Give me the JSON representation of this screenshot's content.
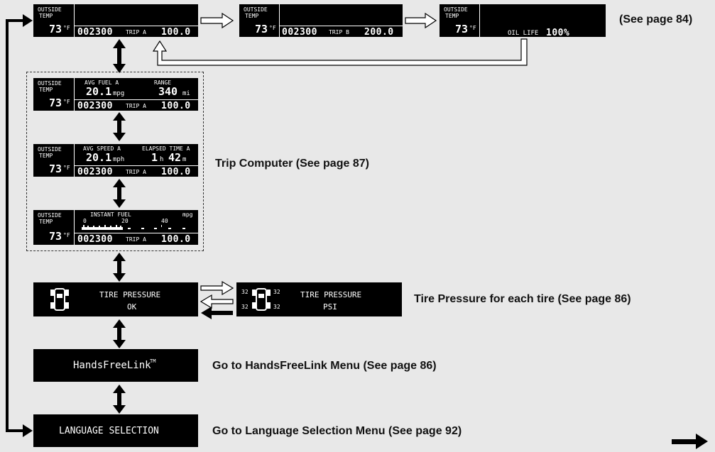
{
  "common": {
    "outside": "OUTSIDE",
    "temp": "TEMP",
    "temp_value": "73",
    "temp_unit": "°F",
    "odometer": "002300"
  },
  "top_displays": [
    {
      "trip_label": "TRIP A",
      "trip_value": "100.0"
    },
    {
      "trip_label": "TRIP B",
      "trip_value": "200.0"
    },
    {
      "oil_life_label": "OIL LIFE",
      "oil_life_value": "100%"
    }
  ],
  "top_caption": "(See page 84)",
  "trip_computer": {
    "caption": "Trip Computer (See page 87)",
    "d1": {
      "left_label": "AVG FUEL A",
      "left_value": "20.1",
      "left_unit": "mpg",
      "right_label": "RANGE",
      "right_value": "340",
      "right_unit": "mi",
      "trip_label": "TRIP A",
      "trip_value": "100.0"
    },
    "d2": {
      "left_label": "AVG SPEED A",
      "left_value": "20.1",
      "left_unit": "mph",
      "right_label": "ELAPSED TIME A",
      "hours": "1",
      "h_unit": "h",
      "minutes": "42",
      "m_unit": "m",
      "trip_label": "TRIP A",
      "trip_value": "100.0"
    },
    "d3": {
      "label": "INSTANT FUEL",
      "unit": "mpg",
      "tick0": "0",
      "tick20": "20",
      "tick40": "40",
      "trip_label": "TRIP A",
      "trip_value": "100.0"
    }
  },
  "tire": {
    "title": "TIRE PRESSURE",
    "status": "OK",
    "psi_label": "PSI",
    "fl": "32",
    "fr": "32",
    "rl": "32",
    "rr": "32",
    "caption": "Tire Pressure for each tire (See page 86)"
  },
  "hfl": {
    "label": "HandsFreeLink",
    "tm": "TM",
    "caption": "Go to HandsFreeLink Menu (See page 86)"
  },
  "language": {
    "label": "LANGUAGE SELECTION",
    "caption": "Go to Language Selection Menu (See page 92)"
  }
}
